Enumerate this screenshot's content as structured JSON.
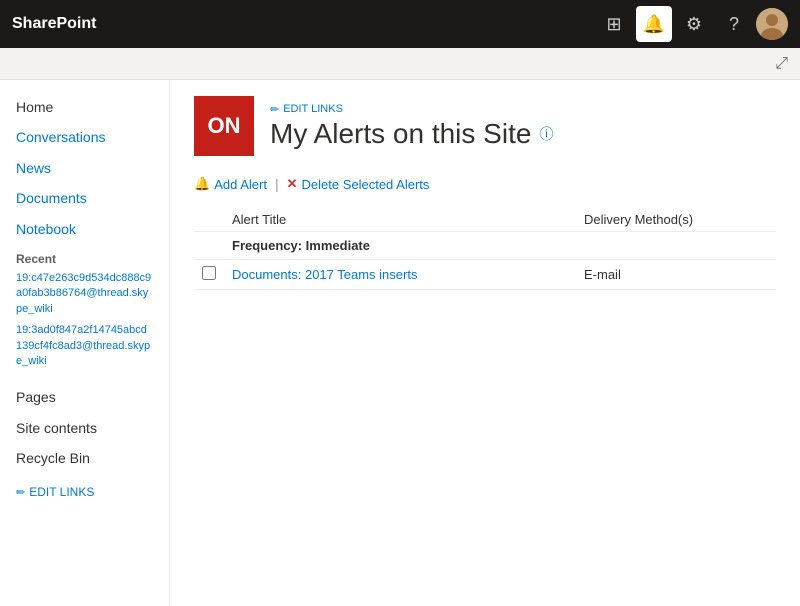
{
  "app": {
    "name": "SharePoint"
  },
  "topbar": {
    "icons": {
      "grid": "⊞",
      "bell": "🔔",
      "gear": "⚙",
      "help": "?",
      "expand": "⤢"
    }
  },
  "site": {
    "logo_text": "ON",
    "edit_links_label": "EDIT LINKS",
    "title": "My Alerts on this Site",
    "info_symbol": "ⓘ"
  },
  "toolbar": {
    "add_alert_label": "Add Alert",
    "separator": "|",
    "delete_label": "Delete Selected Alerts"
  },
  "table": {
    "col_alert_title": "Alert Title",
    "col_delivery": "Delivery Method(s)",
    "frequency_label": "Frequency: Immediate",
    "rows": [
      {
        "title": "Documents: 2017 Teams inserts",
        "delivery": "E-mail"
      }
    ]
  },
  "sidebar": {
    "items": [
      {
        "label": "Home",
        "type": "plain"
      },
      {
        "label": "Conversations",
        "type": "link"
      },
      {
        "label": "News",
        "type": "link"
      },
      {
        "label": "Documents",
        "type": "link"
      },
      {
        "label": "Notebook",
        "type": "link"
      }
    ],
    "section_recent": "Recent",
    "recent_items": [
      {
        "label": "19:c47e263c9d534dc888c9a0fab3b86764@thread.skype_wiki"
      },
      {
        "label": "19:3ad0f847a2f14745abcd139cf4fc8ad3@thread.skype_wiki"
      }
    ],
    "pages_label": "Pages",
    "site_contents_label": "Site contents",
    "recycle_bin_label": "Recycle Bin",
    "edit_links_bottom": "EDIT LINKS"
  }
}
